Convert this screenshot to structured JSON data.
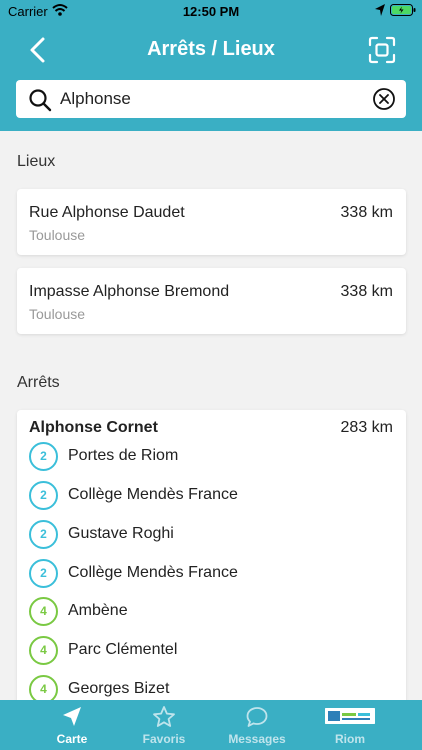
{
  "status_bar": {
    "carrier": "Carrier",
    "time": "12:50 PM"
  },
  "nav": {
    "title": "Arrêts / Lieux"
  },
  "search": {
    "value": "Alphonse"
  },
  "places": {
    "title": "Lieux",
    "items": [
      {
        "name": "Rue Alphonse Daudet",
        "city": "Toulouse",
        "distance": "338 km"
      },
      {
        "name": "Impasse Alphonse Bremond",
        "city": "Toulouse",
        "distance": "338 km"
      }
    ]
  },
  "stops": {
    "title": "Arrêts",
    "items": [
      {
        "name": "Alphonse Cornet",
        "distance": "283 km",
        "destinations": [
          {
            "line": "2",
            "name": "Portes de Riom"
          },
          {
            "line": "2",
            "name": "Collège Mendès France"
          },
          {
            "line": "2",
            "name": "Gustave Roghi"
          },
          {
            "line": "2",
            "name": "Collège Mendès France"
          },
          {
            "line": "4",
            "name": "Ambène"
          },
          {
            "line": "4",
            "name": "Parc Clémentel"
          },
          {
            "line": "4",
            "name": "Georges Bizet"
          }
        ]
      }
    ]
  },
  "tabs": [
    {
      "label": "Carte",
      "icon": "navigation-arrow-icon",
      "active": true
    },
    {
      "label": "Favoris",
      "icon": "star-icon",
      "active": false
    },
    {
      "label": "Messages",
      "icon": "chat-bubble-icon",
      "active": false
    },
    {
      "label": "Riom",
      "icon": "riom-logo-icon",
      "active": false
    }
  ],
  "colors": {
    "header": "#3aafc4",
    "line_2": "#3bbfda",
    "line_4": "#7ac943"
  }
}
